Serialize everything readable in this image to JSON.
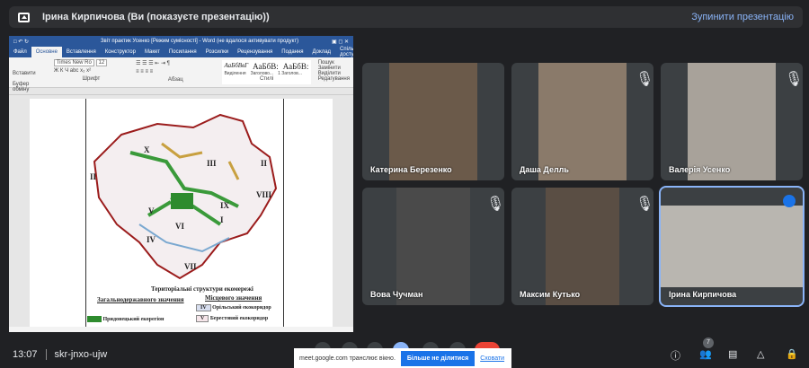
{
  "topbar": {
    "title": "Ірина Кирпичова (Ви (показуєте презентацію))",
    "stop_label": "Зупинити презентацію"
  },
  "word": {
    "title": "Звіт практик Усенко [Режим сумісності] - Word (не вдалося активувати продукт)",
    "tabs": [
      "Файл",
      "Основне",
      "Вставлення",
      "Конструктор",
      "Макет",
      "Посилання",
      "Розсилки",
      "Рецензування",
      "Подання",
      "Доклад",
      "Спільний доступ"
    ],
    "font": "Times New Ro",
    "size": "12",
    "styles": [
      "АаБбВвГ",
      "АаБбВ:",
      "АаБбВ:"
    ],
    "style_names": [
      "Виділення",
      "Заголово...",
      "1 Заголов..."
    ],
    "editing": [
      "Пошук",
      "Замінити",
      "Виділити"
    ],
    "groups": [
      "Буфер обміну",
      "Шрифт",
      "Абзац",
      "Стилі",
      "Редагування"
    ],
    "paste": "Вставити",
    "legend_title": "Територіальні структури екомережі",
    "legend_left": "Загальнодержавного значення",
    "legend_right": "Місцевого значення",
    "legend_items": [
      {
        "code": "IV",
        "label": "Орільський екокоридор"
      },
      {
        "code": "V",
        "label": "Берестовий екокоридор"
      }
    ],
    "legend_green": "Придонецький екорегіон",
    "roman": [
      "X",
      "II",
      "III",
      "VIII",
      "IX",
      "V",
      "VI",
      "IV",
      "I",
      "VII",
      "II"
    ]
  },
  "participants": [
    {
      "name": "Катерина Березенко",
      "muted": false,
      "bg": "#6b5a4a"
    },
    {
      "name": "Даша Делль",
      "muted": true,
      "bg": "#8a7a6a"
    },
    {
      "name": "Валерія Усенко",
      "muted": true,
      "bg": "#a8a29a"
    },
    {
      "name": "Вова Чучман",
      "muted": true,
      "bg": "#4a4a4a"
    },
    {
      "name": "Максим Кутько",
      "muted": true,
      "bg": "#5a4e44"
    },
    {
      "name": "Ірина Кирпичова",
      "muted": false,
      "bg": "#b9b6b0"
    }
  ],
  "bottom": {
    "time": "13:07",
    "code": "skr-jnxo-ujw",
    "people_count": "7"
  },
  "notice": {
    "text": "meet.google.com транслює вікно.",
    "stop": "Більше не ділитися",
    "hide": "Сховати"
  }
}
